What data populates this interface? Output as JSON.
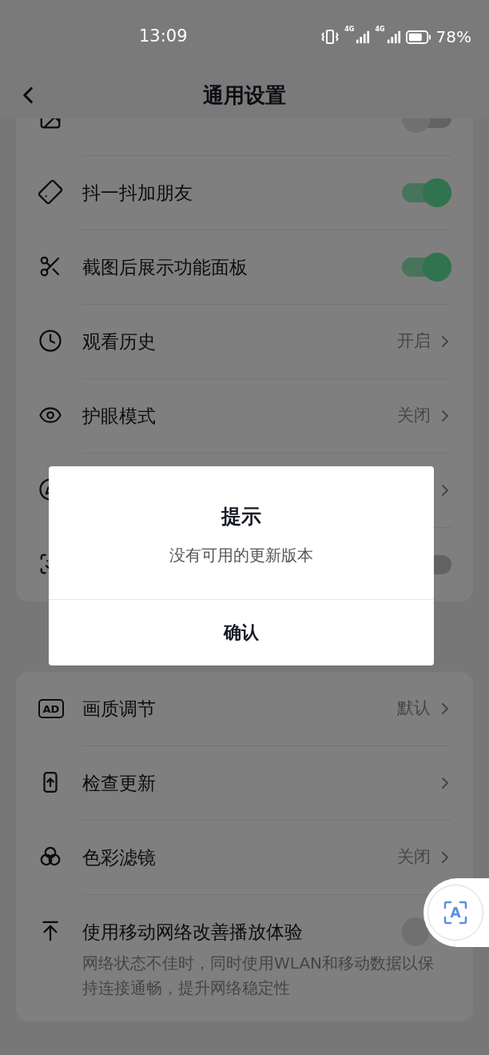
{
  "status_bar": {
    "time": "13:09",
    "network_1": "4G",
    "network_2": "4G",
    "battery": "78%"
  },
  "header": {
    "title": "通用设置"
  },
  "cards": [
    {
      "rows": [
        {
          "kind": "toggle",
          "on": false
        },
        {
          "kind": "toggle",
          "label": "抖一抖加朋友",
          "on": true
        },
        {
          "kind": "toggle",
          "label": "截图后展示功能面板",
          "on": true
        },
        {
          "kind": "link",
          "label": "观看历史",
          "value": "开启"
        },
        {
          "kind": "link",
          "label": "护眼模式",
          "value": "关闭"
        },
        {
          "kind": "link"
        },
        {
          "kind": "toggle",
          "on": false
        }
      ]
    },
    {
      "rows": [
        {
          "kind": "link",
          "badge": "AD",
          "label": "画质调节",
          "value": "默认"
        },
        {
          "kind": "link",
          "label": "检查更新"
        },
        {
          "kind": "link",
          "label": "色彩滤镜",
          "value": "关闭"
        },
        {
          "kind": "toggle",
          "label": "使用移动网络改善播放体验",
          "on": false,
          "description": "网络状态不佳时，同时使用WLAN和移动数据以保持连接通畅，提升网络稳定性"
        }
      ]
    }
  ],
  "dialog": {
    "title": "提示",
    "message": "没有可用的更新版本",
    "button": "确认"
  },
  "float_button": {
    "label": "A"
  }
}
